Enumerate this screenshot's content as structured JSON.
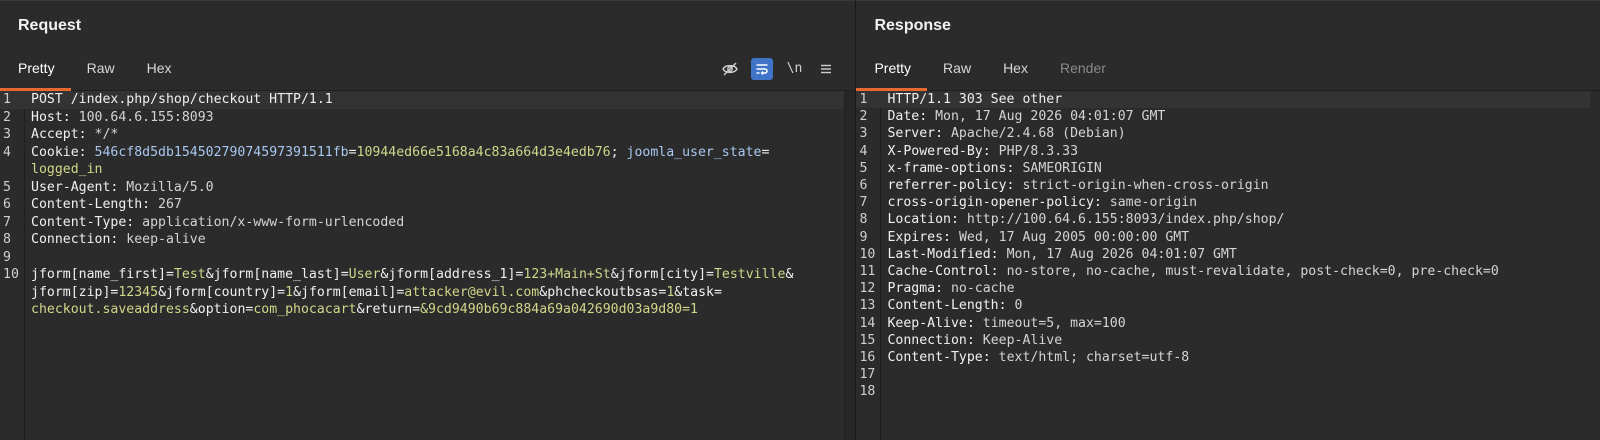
{
  "request": {
    "title": "Request",
    "tabs": [
      "Pretty",
      "Raw",
      "Hex"
    ],
    "active_tab": "Pretty",
    "toolbar": {
      "hide_icon": "eye-off-icon",
      "wrap_icon": "word-wrap-icon",
      "newline_label": "\\n",
      "menu_icon": "hamburger-menu-icon"
    },
    "lines": {
      "l1": {
        "num": "1",
        "text": "POST /index.php/shop/checkout HTTP/1.1"
      },
      "l2": {
        "num": "2",
        "key": "Host:",
        "val": " 100.64.6.155:8093"
      },
      "l3": {
        "num": "3",
        "key": "Accept:",
        "val": " */*"
      },
      "l4": {
        "num": "4",
        "key": "Cookie:",
        "c1_name": " 546cf8d5db15450279074597391511fb",
        "eq1": "=",
        "c1_val": "10944ed66e5168a4c83a664d3e4edb76",
        "sep": "; ",
        "c2_name": "joomla_user_state",
        "eq2": "=",
        "c2_val": "logged_in"
      },
      "l5": {
        "num": "5",
        "key": "User-Agent:",
        "val": " Mozilla/5.0"
      },
      "l6": {
        "num": "6",
        "key": "Content-Length:",
        "val": " 267"
      },
      "l7": {
        "num": "7",
        "key": "Content-Type:",
        "val": " application/x-www-form-urlencoded"
      },
      "l8": {
        "num": "8",
        "key": "Connection:",
        "val": " keep-alive"
      },
      "l9": {
        "num": "9"
      },
      "l10": {
        "num": "10",
        "p1n": "jform[name_first]",
        "p1e": "=",
        "p1v": "Test",
        "a1": "&",
        "p2n": "jform[name_last]",
        "p2e": "=",
        "p2v": "User",
        "a2": "&",
        "p3n": "jform[address_1]",
        "p3e": "=",
        "p3v": "123+Main+St",
        "a3": "&",
        "p4n": "jform[city]",
        "p4e": "=",
        "p4v": "Testville",
        "a4": "&",
        "p5n": "jform[zip]",
        "p5e": "=",
        "p5v": "12345",
        "a5": "&",
        "p6n": "jform[country]",
        "p6e": "=",
        "p6v": "1",
        "a6": "&",
        "p7n": "jform[email]",
        "p7e": "=",
        "p7v": "attacker@evil.com",
        "a7": "&",
        "p8n": "phcheckoutbsas",
        "p8e": "=",
        "p8v": "1",
        "a8": "&",
        "p9n": "task",
        "p9e": "=",
        "p9v": "checkout.saveaddress",
        "a9": "&",
        "p10n": "option",
        "p10e": "=",
        "p10v": "com_phocacart",
        "a10": "&",
        "p11n": "return",
        "p11e": "=",
        "p11v": "&9cd9490b69c884a69a042690d03a9d80=1"
      }
    }
  },
  "response": {
    "title": "Response",
    "tabs": [
      "Pretty",
      "Raw",
      "Hex",
      "Render"
    ],
    "active_tab": "Pretty",
    "lines": [
      {
        "num": "1",
        "text": "HTTP/1.1 303 See other"
      },
      {
        "num": "2",
        "key": "Date:",
        "val": " Mon, 17 Aug 2026 04:01:07 GMT"
      },
      {
        "num": "3",
        "key": "Server:",
        "val": " Apache/2.4.68 (Debian)"
      },
      {
        "num": "4",
        "key": "X-Powered-By:",
        "val": " PHP/8.3.33"
      },
      {
        "num": "5",
        "key": "x-frame-options:",
        "val": " SAMEORIGIN"
      },
      {
        "num": "6",
        "key": "referrer-policy:",
        "val": " strict-origin-when-cross-origin"
      },
      {
        "num": "7",
        "key": "cross-origin-opener-policy:",
        "val": " same-origin"
      },
      {
        "num": "8",
        "key": "Location:",
        "val": " http://100.64.6.155:8093/index.php/shop/"
      },
      {
        "num": "9",
        "key": "Expires:",
        "val": " Wed, 17 Aug 2005 00:00:00 GMT"
      },
      {
        "num": "10",
        "key": "Last-Modified:",
        "val": " Mon, 17 Aug 2026 04:01:07 GMT"
      },
      {
        "num": "11",
        "key": "Cache-Control:",
        "val": " no-store, no-cache, must-revalidate, post-check=0, pre-check=0"
      },
      {
        "num": "12",
        "key": "Pragma:",
        "val": " no-cache"
      },
      {
        "num": "13",
        "key": "Content-Length:",
        "val": " 0"
      },
      {
        "num": "14",
        "key": "Keep-Alive:",
        "val": " timeout=5, max=100"
      },
      {
        "num": "15",
        "key": "Connection:",
        "val": " Keep-Alive"
      },
      {
        "num": "16",
        "key": "Content-Type:",
        "val": " text/html; charset=utf-8"
      },
      {
        "num": "17"
      },
      {
        "num": "18"
      }
    ]
  },
  "colors": {
    "accent_tab_underline": "#e8692f",
    "toolbar_active": "#3f74c8",
    "param_value": "#d0d68a",
    "cookie_name": "#a9c7f0"
  }
}
